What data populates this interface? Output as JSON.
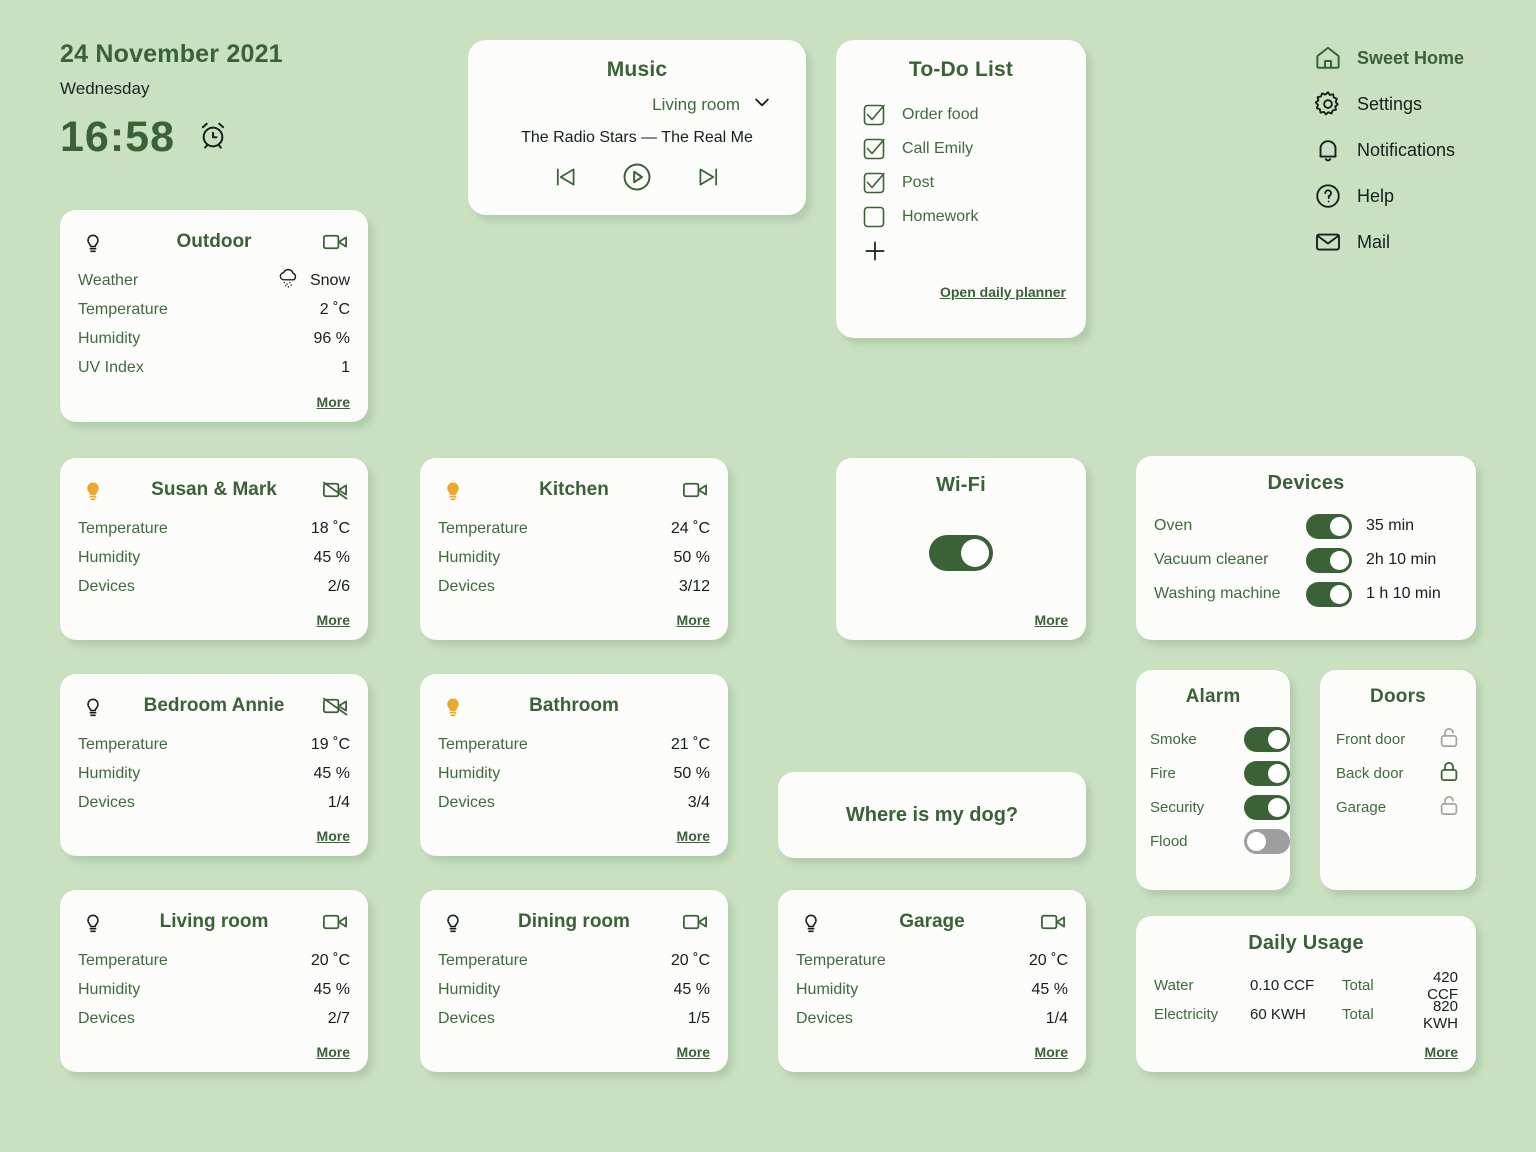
{
  "header": {
    "date": "24 November 2021",
    "weekday": "Wednesday",
    "time": "16:58",
    "alarm_icon": "alarm-clock-icon"
  },
  "nav": {
    "items": [
      {
        "label": "Sweet Home",
        "icon": "home-icon",
        "active": true
      },
      {
        "label": "Settings",
        "icon": "gear-icon",
        "active": false
      },
      {
        "label": "Notifications",
        "icon": "bell-icon",
        "active": false
      },
      {
        "label": "Help",
        "icon": "question-mark-icon",
        "active": false
      },
      {
        "label": "Mail",
        "icon": "envelope-icon",
        "active": false
      }
    ]
  },
  "music": {
    "title": "Music",
    "room": "Living room",
    "track": "The Radio Stars — The Real Me",
    "prev_icon": "skip-previous-icon",
    "play_icon": "play-circle-icon",
    "next_icon": "skip-next-icon",
    "chevron_icon": "chevron-down-icon"
  },
  "todo": {
    "title": "To-Do List",
    "items": [
      {
        "label": "Order food",
        "done": true
      },
      {
        "label": "Call Emily",
        "done": true
      },
      {
        "label": "Post",
        "done": true
      },
      {
        "label": "Homework",
        "done": false
      }
    ],
    "add_icon": "plus-icon",
    "link": "Open daily planner"
  },
  "outdoor": {
    "name": "Outdoor",
    "bulb": "off",
    "camera": "on",
    "more": "More",
    "rows": [
      {
        "key": "Weather",
        "value": "Snow",
        "icon": "snow-cloud-icon"
      },
      {
        "key": "Temperature",
        "value": "2 ˚C"
      },
      {
        "key": "Humidity",
        "value": "96 %"
      },
      {
        "key": "UV Index",
        "value": "1"
      }
    ]
  },
  "rooms": [
    {
      "id": "susan",
      "name": "Susan & Mark",
      "bulb": "on",
      "camera": "off",
      "more": "More",
      "rows": [
        {
          "key": "Temperature",
          "value": "18 ˚C"
        },
        {
          "key": "Humidity",
          "value": "45 %"
        },
        {
          "key": "Devices",
          "value": "2/6"
        }
      ]
    },
    {
      "id": "kitchen",
      "name": "Kitchen",
      "bulb": "on",
      "camera": "on",
      "more": "More",
      "rows": [
        {
          "key": "Temperature",
          "value": "24 ˚C"
        },
        {
          "key": "Humidity",
          "value": "50 %"
        },
        {
          "key": "Devices",
          "value": "3/12"
        }
      ]
    },
    {
      "id": "bedroom",
      "name": "Bedroom Annie",
      "bulb": "off",
      "camera": "off",
      "more": "More",
      "rows": [
        {
          "key": "Temperature",
          "value": "19 ˚C"
        },
        {
          "key": "Humidity",
          "value": "45 %"
        },
        {
          "key": "Devices",
          "value": "1/4"
        }
      ]
    },
    {
      "id": "bathroom",
      "name": "Bathroom",
      "bulb": "on",
      "camera": "none",
      "more": "More",
      "rows": [
        {
          "key": "Temperature",
          "value": "21 ˚C"
        },
        {
          "key": "Humidity",
          "value": "50 %"
        },
        {
          "key": "Devices",
          "value": "3/4"
        }
      ]
    },
    {
      "id": "living",
      "name": "Living room",
      "bulb": "off",
      "camera": "on-left",
      "more": "More",
      "rows": [
        {
          "key": "Temperature",
          "value": "20 ˚C"
        },
        {
          "key": "Humidity",
          "value": "45 %"
        },
        {
          "key": "Devices",
          "value": "2/7"
        }
      ]
    },
    {
      "id": "dining",
      "name": "Dining room",
      "bulb": "off",
      "camera": "on-left",
      "more": "More",
      "rows": [
        {
          "key": "Temperature",
          "value": "20 ˚C"
        },
        {
          "key": "Humidity",
          "value": "45 %"
        },
        {
          "key": "Devices",
          "value": "1/5"
        }
      ]
    },
    {
      "id": "garage",
      "name": "Garage",
      "bulb": "off",
      "camera": "on-left",
      "more": "More",
      "rows": [
        {
          "key": "Temperature",
          "value": "20 ˚C"
        },
        {
          "key": "Humidity",
          "value": "45 %"
        },
        {
          "key": "Devices",
          "value": "1/4"
        }
      ]
    }
  ],
  "wifi": {
    "title": "Wi-Fi",
    "state": "on",
    "more": "More"
  },
  "dog": {
    "label": "Where is my dog?"
  },
  "devices": {
    "title": "Devices",
    "rows": [
      {
        "name": "Oven",
        "state": "on",
        "time": "35 min"
      },
      {
        "name": "Vacuum cleaner",
        "state": "on",
        "time": "2h 10 min"
      },
      {
        "name": "Washing machine",
        "state": "on",
        "time": "1 h 10 min"
      }
    ]
  },
  "alarm": {
    "title": "Alarm",
    "rows": [
      {
        "name": "Smoke",
        "state": "on"
      },
      {
        "name": "Fire",
        "state": "on"
      },
      {
        "name": "Security",
        "state": "on"
      },
      {
        "name": "Flood",
        "state": "off"
      }
    ]
  },
  "doors": {
    "title": "Doors",
    "rows": [
      {
        "name": "Front door",
        "state": "unlocked",
        "icon": "padlock-open-icon"
      },
      {
        "name": "Back door",
        "state": "locked",
        "icon": "padlock-closed-icon"
      },
      {
        "name": "Garage",
        "state": "unlocked",
        "icon": "padlock-open-icon"
      }
    ]
  },
  "usage": {
    "title": "Daily Usage",
    "more": "More",
    "rows": [
      {
        "name": "Water",
        "value": "0.10 CCF",
        "total_label": "Total",
        "total": "420 CCF"
      },
      {
        "name": "Electricity",
        "value": "60 KWH",
        "total_label": "Total",
        "total": "820 KWH"
      }
    ]
  },
  "colors": {
    "background": "#c9e1c1",
    "card": "#fcfcfb",
    "accent_green": "#3b6137",
    "label_green": "#3f6b3c",
    "bulb_on": "#eca92f",
    "toggle_off": "#9e9e9e",
    "lock_gray": "#a0a7a0"
  }
}
